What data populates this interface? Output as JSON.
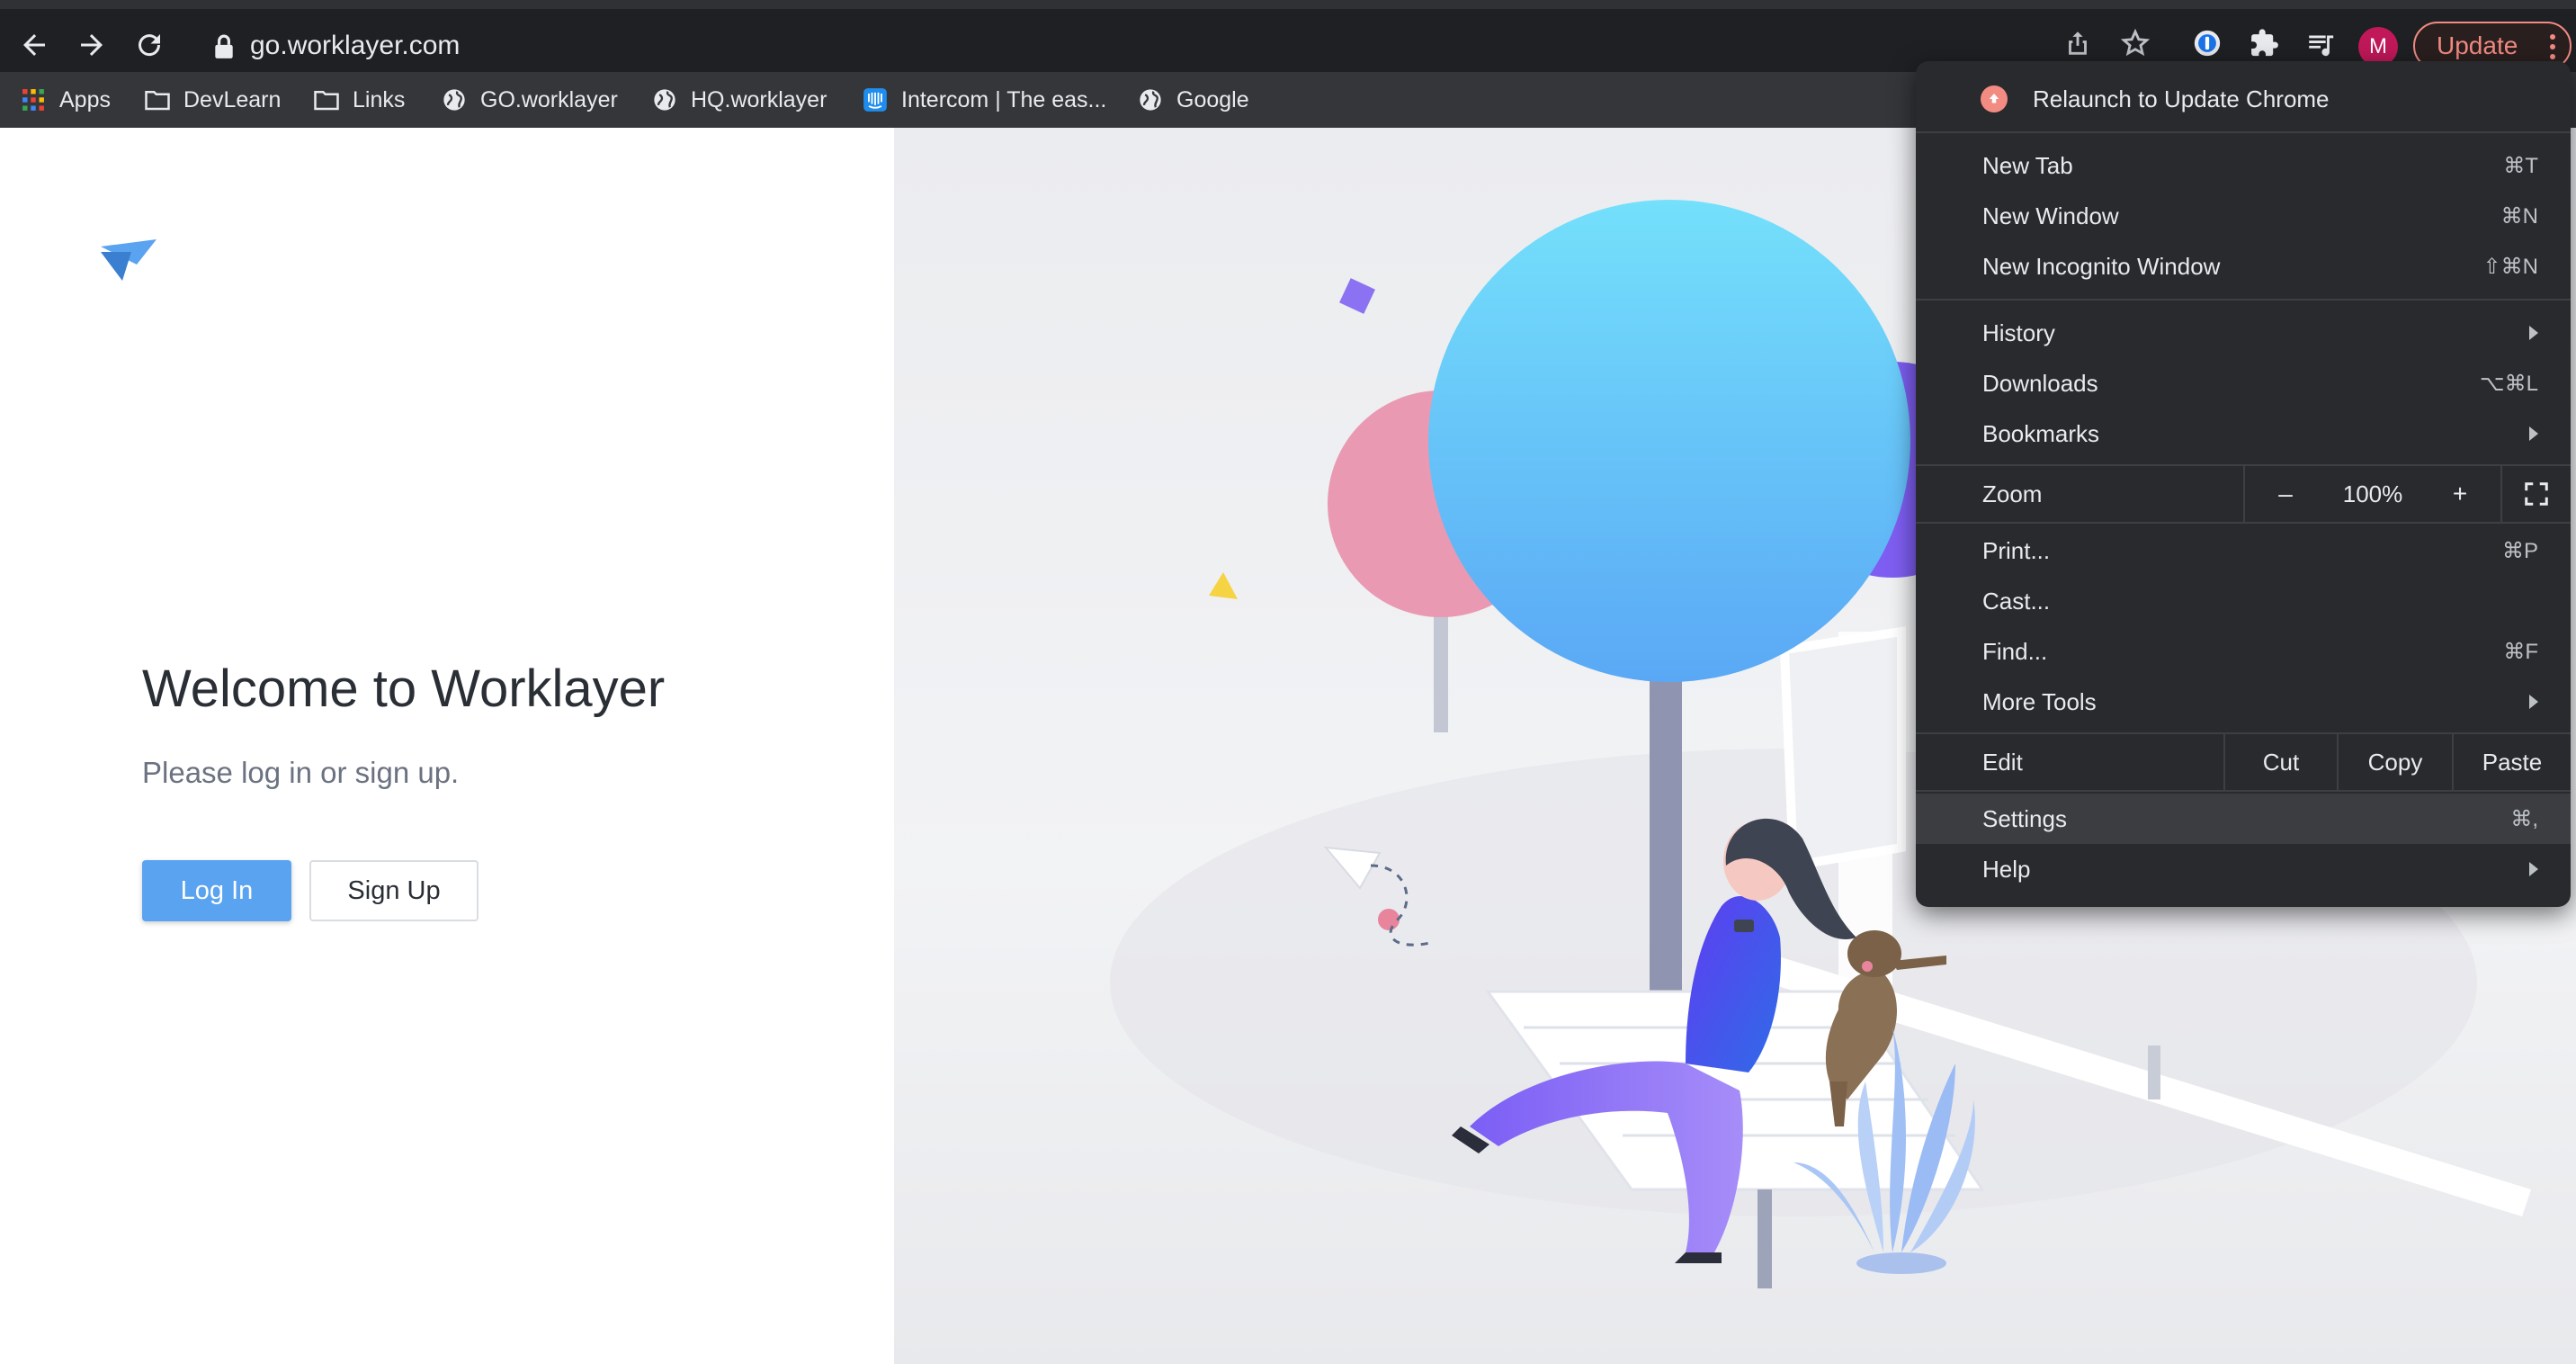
{
  "browser": {
    "url": "go.worklayer.com",
    "profile_initial": "M",
    "update_label": "Update",
    "accent_update": "#f28b82"
  },
  "bookmarks": [
    {
      "label": "Apps",
      "icon": "apps-grid-icon"
    },
    {
      "label": "DevLearn",
      "icon": "folder-icon"
    },
    {
      "label": "Links",
      "icon": "folder-icon"
    },
    {
      "label": "GO.worklayer",
      "icon": "globe-icon"
    },
    {
      "label": "HQ.worklayer",
      "icon": "globe-icon"
    },
    {
      "label": "Intercom | The eas...",
      "icon": "intercom-icon"
    },
    {
      "label": "Google",
      "icon": "globe-icon"
    }
  ],
  "page": {
    "welcome": "Welcome to Worklayer",
    "subtitle": "Please log in or sign up.",
    "login_label": "Log In",
    "signup_label": "Sign Up",
    "brand_color": "#5aa3f0"
  },
  "menu": {
    "relaunch": "Relaunch to Update Chrome",
    "items_top": [
      {
        "label": "New Tab",
        "shortcut": "⌘T"
      },
      {
        "label": "New Window",
        "shortcut": "⌘N"
      },
      {
        "label": "New Incognito Window",
        "shortcut": "⇧⌘N"
      }
    ],
    "items_nav": [
      {
        "label": "History",
        "shortcut": ""
      },
      {
        "label": "Downloads",
        "shortcut": "⌥⌘L"
      },
      {
        "label": "Bookmarks",
        "shortcut": ""
      }
    ],
    "zoom": {
      "label": "Zoom",
      "minus": "–",
      "value": "100%",
      "plus": "+"
    },
    "items_tools": [
      {
        "label": "Print...",
        "shortcut": "⌘P"
      },
      {
        "label": "Cast...",
        "shortcut": ""
      },
      {
        "label": "Find...",
        "shortcut": "⌘F"
      },
      {
        "label": "More Tools",
        "shortcut": ""
      }
    ],
    "edit": {
      "label": "Edit",
      "cut": "Cut",
      "copy": "Copy",
      "paste": "Paste"
    },
    "settings": {
      "label": "Settings",
      "shortcut": "⌘,"
    },
    "help": {
      "label": "Help"
    }
  }
}
